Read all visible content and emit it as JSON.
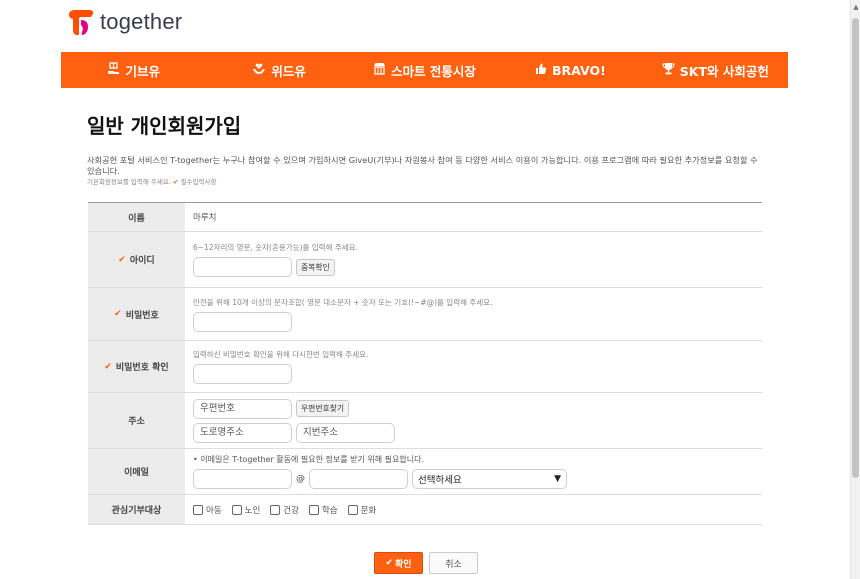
{
  "brand": {
    "logo_text": "together",
    "accent_color": "#ff6110"
  },
  "nav": {
    "items": [
      {
        "label": "기브유",
        "icon": "hand-gift-icon"
      },
      {
        "label": "위드유",
        "icon": "hands-heart-icon"
      },
      {
        "label": "스마트 전통시장",
        "icon": "market-icon"
      },
      {
        "label": "BRAVO!",
        "icon": "thumbs-up-icon"
      },
      {
        "label": "SKT와 사회공헌",
        "icon": "trophy-icon"
      }
    ]
  },
  "page": {
    "title": "일반 개인회원가입",
    "intro": "사회공헌 포털 서비스인 T-together는 누구나 참여할 수 있으며 가입하시면 GiveU(기부)나 자원봉사 참여 등 다양한 서비스 이용이 가능합니다. 이용 프로그램에 따라 필요한 추가정보를 요청할 수 있습니다.",
    "required_note_prefix": "기본회원정보를 입력해 주세요.",
    "required_note_mark": "✔",
    "required_note_suffix": "필수입력사항"
  },
  "form": {
    "name": {
      "label": "이름",
      "value": "마루치"
    },
    "user_id": {
      "label": "아이디",
      "help": "6~12자리의 영문, 숫자(혼용가능)를 입력해 주세요.",
      "value": "",
      "check_button": "중복확인"
    },
    "password": {
      "label": "비밀번호",
      "help": "안전을 위해 10개 이상의 문자조합( 영문 대소문자 + 숫자 또는 기호(!~#@)를 입력해 주세요.",
      "value": ""
    },
    "password_confirm": {
      "label": "비밀번호 확인",
      "help": "입력하신 비밀번호 확인을 위해 다시한번 입력해 주세요.",
      "value": ""
    },
    "address": {
      "label": "주소",
      "postcode_placeholder": "우편번호",
      "search_button": "우편번호찾기",
      "road_placeholder": "도로명주소",
      "lot_placeholder": "지번주소"
    },
    "email": {
      "label": "이메일",
      "help": "• 이메일은 T-together 활동에 필요한 정보를 받기 위해 필요합니다.",
      "local_value": "",
      "at": "@",
      "domain_value": "",
      "domain_select": "선택하세요"
    },
    "interests": {
      "label": "관심기부대상",
      "options": [
        "아동",
        "노인",
        "건강",
        "학습",
        "문화"
      ]
    }
  },
  "actions": {
    "confirm": "확인",
    "cancel": "취소"
  }
}
